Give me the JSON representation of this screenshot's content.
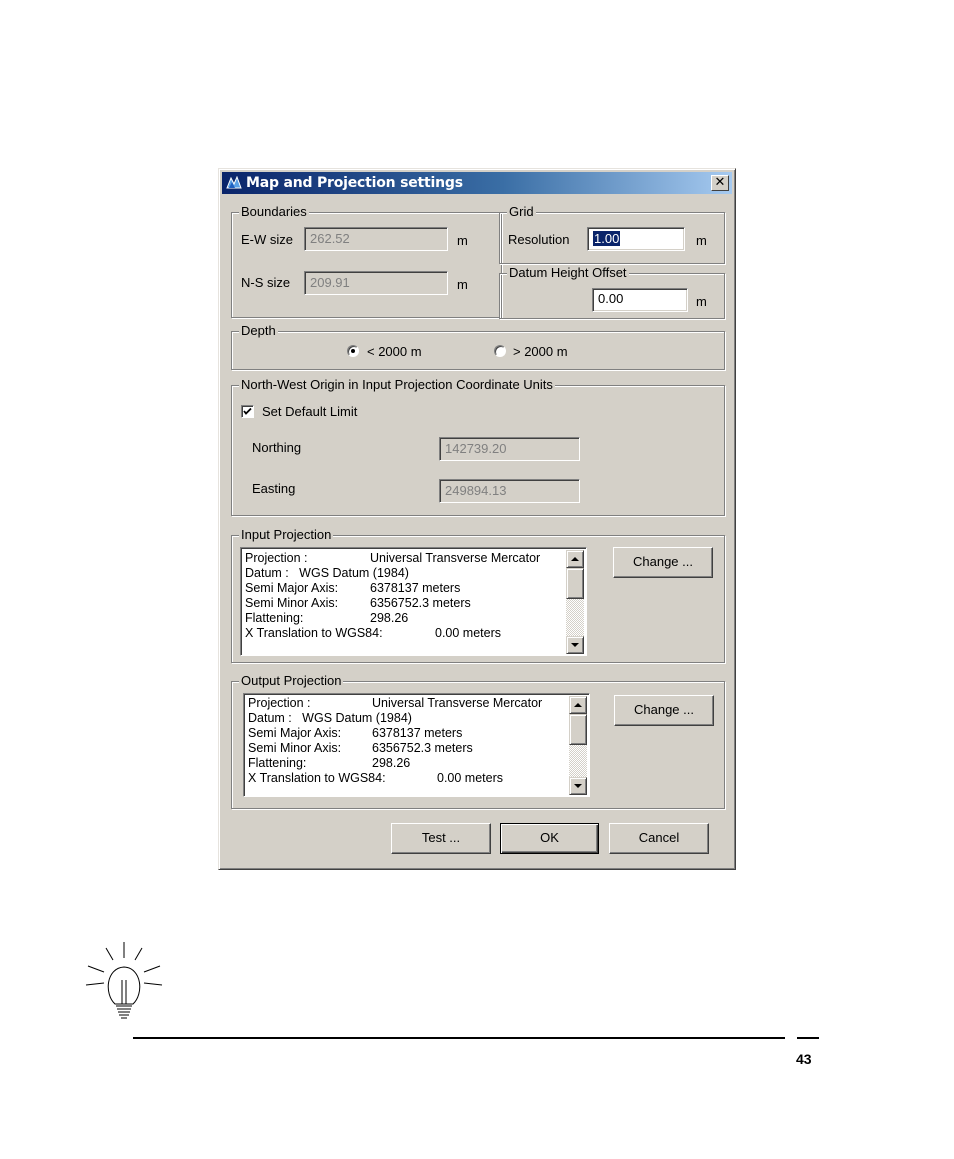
{
  "dialog": {
    "title": "Map and Projection settings",
    "close_glyph": "✕",
    "icon": "map-projection-icon"
  },
  "boundaries": {
    "legend": "Boundaries",
    "ew_label": "E-W size",
    "ew_value": "262.52",
    "ew_unit": "m",
    "ns_label": "N-S size",
    "ns_value": "209.91",
    "ns_unit": "m"
  },
  "grid": {
    "legend": "Grid",
    "resolution_label": "Resolution",
    "resolution_value": "1.00",
    "unit": "m"
  },
  "datum_height": {
    "legend": "Datum Height Offset",
    "value": "0.00",
    "unit": "m"
  },
  "depth": {
    "legend": "Depth",
    "option_shallow": "< 2000 m",
    "option_deep": "> 2000 m",
    "selected": "shallow"
  },
  "origin": {
    "legend": "North-West Origin in Input Projection Coordinate Units",
    "default_limit_label": "Set Default Limit",
    "default_limit_checked": true,
    "northing_label": "Northing",
    "northing_value": "142739.20",
    "easting_label": "Easting",
    "easting_value": "249894.13"
  },
  "input_projection": {
    "legend": "Input Projection",
    "change_label": "Change ...",
    "lines": [
      [
        "Projection :",
        "Universal Transverse Mercator"
      ],
      [
        "Datum :   WGS Datum (1984)",
        ""
      ],
      [
        "Semi Major Axis:",
        "6378137 meters"
      ],
      [
        "Semi Minor Axis:",
        "6356752.3 meters"
      ],
      [
        "Flattening:",
        "298.26"
      ],
      [
        "X Translation to WGS84:",
        "0.00 meters"
      ]
    ]
  },
  "output_projection": {
    "legend": "Output Projection",
    "change_label": "Change ...",
    "lines": [
      [
        "Projection :",
        "Universal Transverse Mercator"
      ],
      [
        "Datum :   WGS Datum (1984)",
        ""
      ],
      [
        "Semi Major Axis:",
        "6378137 meters"
      ],
      [
        "Semi Minor Axis:",
        "6356752.3 meters"
      ],
      [
        "Flattening:",
        "298.26"
      ],
      [
        "X Translation to WGS84:",
        "0.00 meters"
      ]
    ]
  },
  "buttons": {
    "test": "Test ...",
    "ok": "OK",
    "cancel": "Cancel"
  },
  "page": {
    "number": "43",
    "tip_icon": "lightbulb-icon"
  }
}
